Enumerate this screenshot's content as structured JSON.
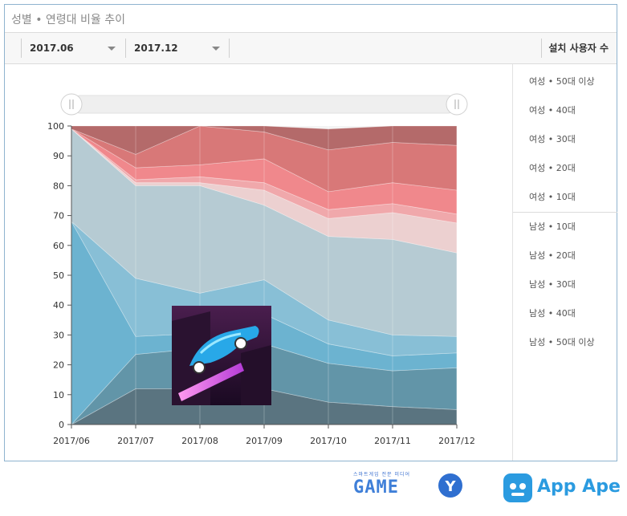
{
  "header": {
    "title": "성별 • 연령대 비율 추이"
  },
  "toolbar": {
    "from": "2017.06",
    "to": "2017.12",
    "metric": "설치 사용자 수"
  },
  "legend": {
    "female": [
      "여성 • 50대 이상",
      "여성 • 40대",
      "여성 • 30대",
      "여성 • 20대",
      "여성 • 10대"
    ],
    "male": [
      "남성 • 10대",
      "남성 • 20대",
      "남성 • 30대",
      "남성 • 40대",
      "남성 • 50대 이상"
    ]
  },
  "logos": {
    "game_small": "스마트게임 전문 미디어",
    "game": "GAME",
    "appape": "App Ape"
  },
  "colors": {
    "male50": "#5a7480",
    "male40": "#6295a8",
    "male30": "#6cb3d0",
    "male20": "#88bfd6",
    "male10": "#b6cbd3",
    "female10": "#ecd0d0",
    "female20": "#f0a8ab",
    "female30": "#f0888c",
    "female40": "#d87878",
    "female50": "#b46a6a"
  },
  "chart_data": {
    "type": "area",
    "stacked": true,
    "x": [
      "2017/06",
      "2017/07",
      "2017/08",
      "2017/09",
      "2017/10",
      "2017/11",
      "2017/12"
    ],
    "ylim": [
      0,
      100
    ],
    "yticks": [
      0,
      10,
      20,
      30,
      40,
      50,
      60,
      70,
      80,
      90,
      100
    ],
    "series": [
      {
        "name": "남성 • 50대 이상",
        "values": [
          0,
          12,
          12,
          12,
          7.5,
          6,
          5
        ]
      },
      {
        "name": "남성 • 40대",
        "values": [
          0,
          11.5,
          13.5,
          15,
          13,
          12,
          14
        ]
      },
      {
        "name": "남성 • 30대",
        "values": [
          68,
          6,
          5,
          10,
          6.5,
          5,
          5
        ]
      },
      {
        "name": "남성 • 20대",
        "values": [
          0,
          19.5,
          13.5,
          11.5,
          8,
          7,
          5.5
        ]
      },
      {
        "name": "남성 • 10대",
        "values": [
          31,
          31,
          36,
          25,
          28,
          32,
          28
        ]
      },
      {
        "name": "여성 • 10대",
        "values": [
          0,
          1,
          1,
          5,
          6,
          9,
          10
        ]
      },
      {
        "name": "여성 • 20대",
        "values": [
          0,
          1,
          2,
          2.5,
          3,
          3,
          3
        ]
      },
      {
        "name": "여성 • 30대",
        "values": [
          0,
          4,
          4,
          8,
          6,
          7,
          8
        ]
      },
      {
        "name": "여성 • 40대",
        "values": [
          0,
          4.5,
          13,
          9,
          14,
          13.5,
          15
        ]
      },
      {
        "name": "여성 • 50대 이상",
        "values": [
          1,
          9.5,
          0,
          2,
          7,
          5.5,
          6.5
        ]
      }
    ]
  }
}
